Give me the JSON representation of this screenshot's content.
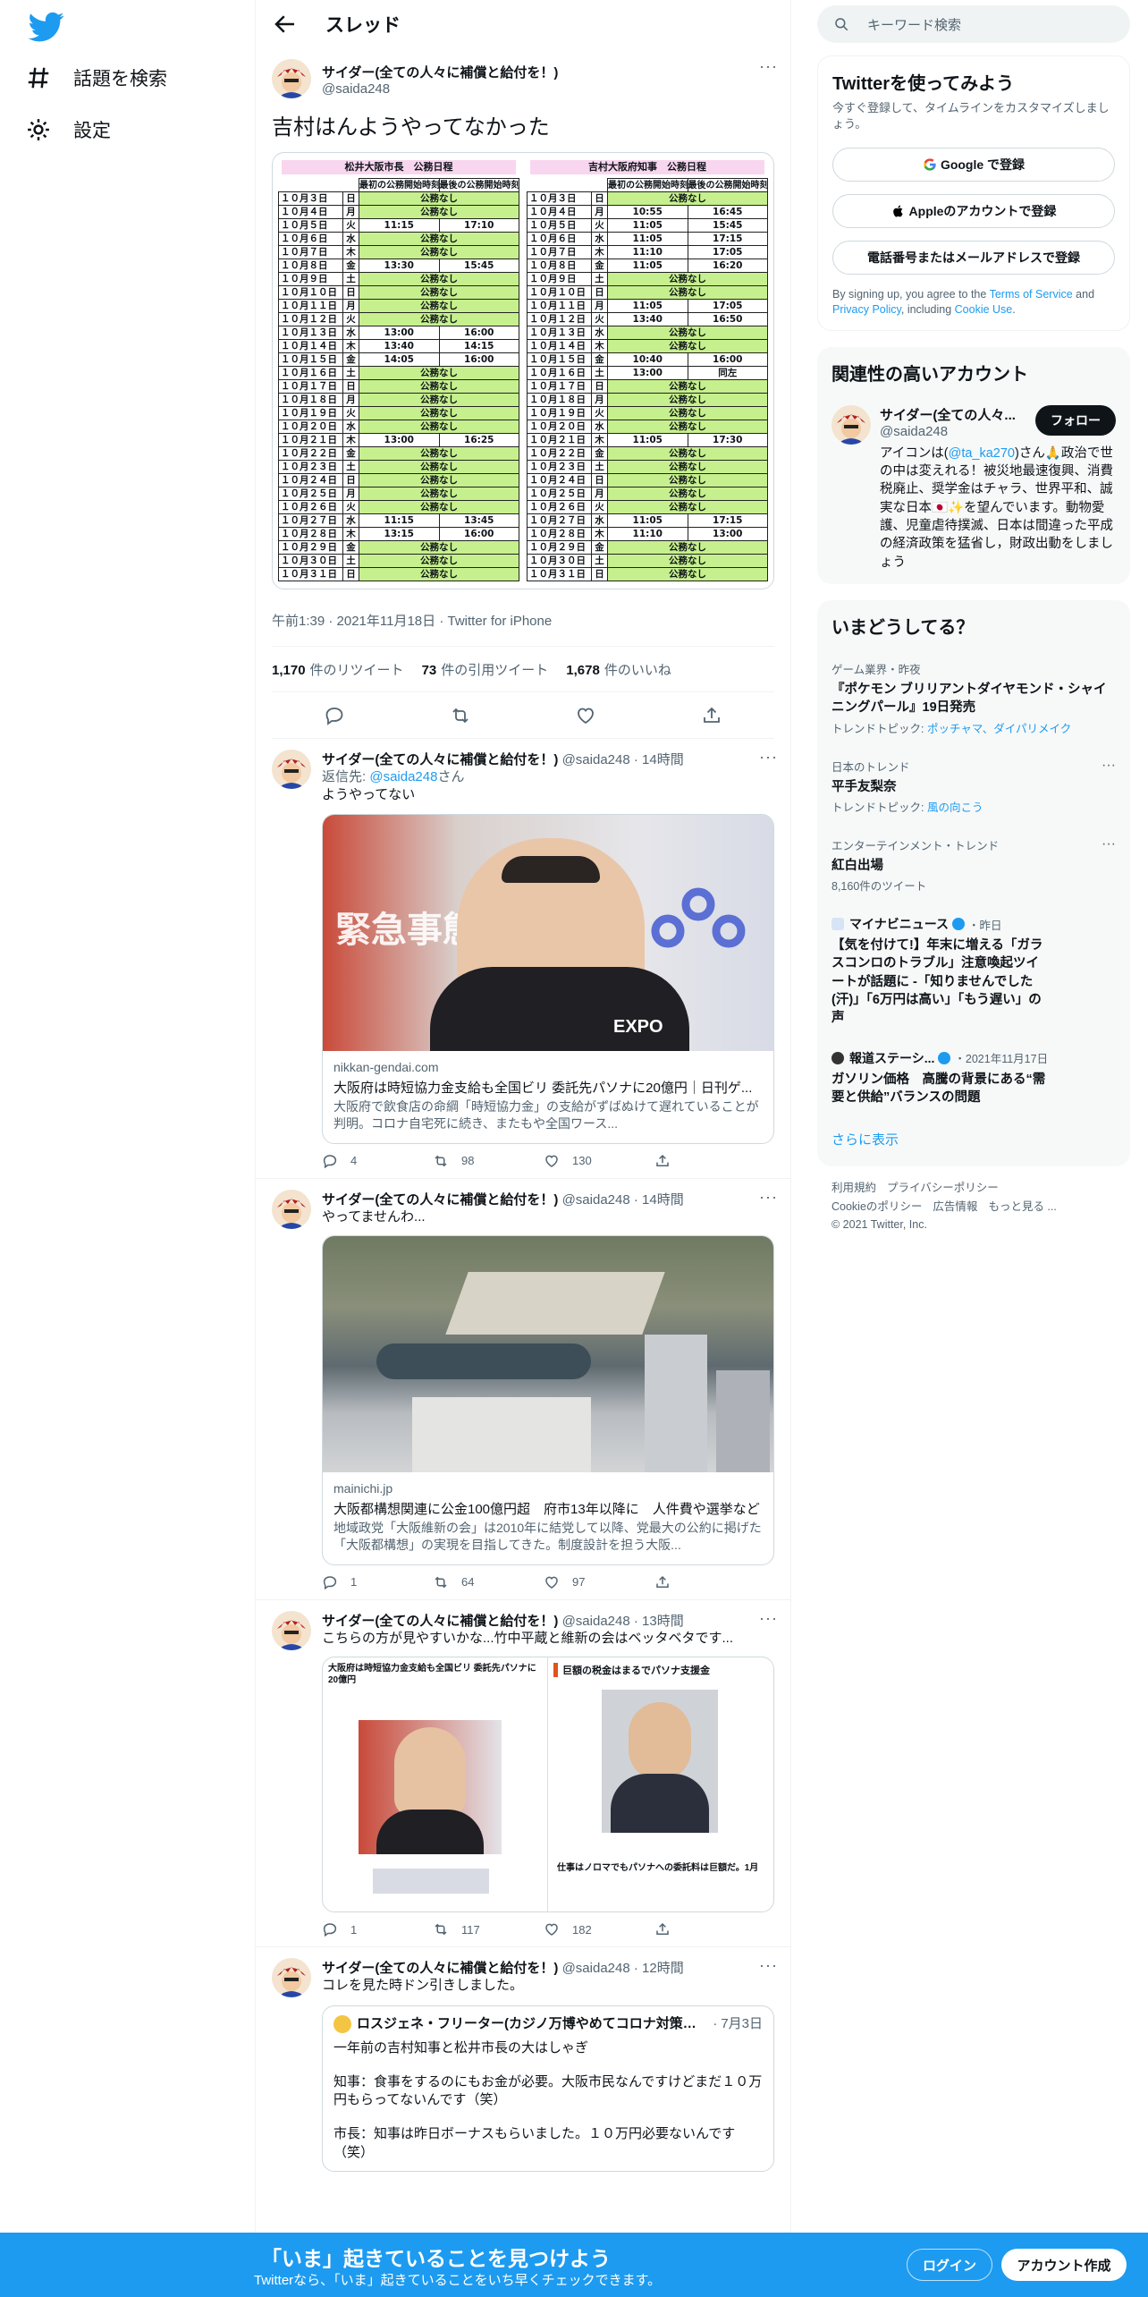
{
  "nav": {
    "explore_label": "話題を検索",
    "settings_label": "設定"
  },
  "header": {
    "title": "スレッド"
  },
  "focal_tweet": {
    "user_name": "サイダー(全ての人々に補償と給付を！)",
    "handle": "@saida248",
    "text": "吉村はんようやってなかった",
    "meta": "午前1:39 · 2021年11月18日 · Twitter for iPhone",
    "retweets": "1,170",
    "retweets_label": "件のリツイート",
    "quotes": "73",
    "quotes_label": "件の引用ツイート",
    "likes": "1,678",
    "likes_label": "件のいいね"
  },
  "schedule_image": {
    "left_title": "松井大阪市長　公務日程",
    "right_title": "吉村大阪府知事　公務日程",
    "col_start": "最初の公務開始時刻",
    "col_end": "最後の公務開始時刻",
    "left_rows": [
      [
        "１０月３日",
        "日",
        "公務なし",
        ""
      ],
      [
        "１０月４日",
        "月",
        "公務なし",
        ""
      ],
      [
        "１０月５日",
        "火",
        "11:15",
        "17:10"
      ],
      [
        "１０月６日",
        "水",
        "公務なし",
        ""
      ],
      [
        "１０月７日",
        "木",
        "公務なし",
        ""
      ],
      [
        "１０月８日",
        "金",
        "13:30",
        "15:45"
      ],
      [
        "１０月９日",
        "土",
        "公務なし",
        ""
      ],
      [
        "１０月１０日",
        "日",
        "公務なし",
        ""
      ],
      [
        "１０月１１日",
        "月",
        "公務なし",
        ""
      ],
      [
        "１０月１２日",
        "火",
        "公務なし",
        ""
      ],
      [
        "１０月１３日",
        "水",
        "13:00",
        "16:00"
      ],
      [
        "１０月１４日",
        "木",
        "13:40",
        "14:15"
      ],
      [
        "１０月１５日",
        "金",
        "14:05",
        "16:00"
      ],
      [
        "１０月１６日",
        "土",
        "公務なし",
        ""
      ],
      [
        "１０月１７日",
        "日",
        "公務なし",
        ""
      ],
      [
        "１０月１８日",
        "月",
        "公務なし",
        ""
      ],
      [
        "１０月１９日",
        "火",
        "公務なし",
        ""
      ],
      [
        "１０月２０日",
        "水",
        "公務なし",
        ""
      ],
      [
        "１０月２１日",
        "木",
        "13:00",
        "16:25"
      ],
      [
        "１０月２２日",
        "金",
        "公務なし",
        ""
      ],
      [
        "１０月２３日",
        "土",
        "公務なし",
        ""
      ],
      [
        "１０月２４日",
        "日",
        "公務なし",
        ""
      ],
      [
        "１０月２５日",
        "月",
        "公務なし",
        ""
      ],
      [
        "１０月２６日",
        "火",
        "公務なし",
        ""
      ],
      [
        "１０月２７日",
        "水",
        "11:15",
        "13:45"
      ],
      [
        "１０月２８日",
        "木",
        "13:15",
        "16:00"
      ],
      [
        "１０月２９日",
        "金",
        "公務なし",
        ""
      ],
      [
        "１０月３０日",
        "土",
        "公務なし",
        ""
      ],
      [
        "１０月３１日",
        "日",
        "公務なし",
        ""
      ]
    ],
    "right_rows": [
      [
        "１０月３日",
        "日",
        "公務なし",
        ""
      ],
      [
        "１０月４日",
        "月",
        "10:55",
        "16:45"
      ],
      [
        "１０月５日",
        "火",
        "11:05",
        "15:45"
      ],
      [
        "１０月６日",
        "水",
        "11:05",
        "17:15"
      ],
      [
        "１０月７日",
        "木",
        "11:10",
        "17:05"
      ],
      [
        "１０月８日",
        "金",
        "11:05",
        "16:20"
      ],
      [
        "１０月９日",
        "土",
        "公務なし",
        ""
      ],
      [
        "１０月１０日",
        "日",
        "公務なし",
        ""
      ],
      [
        "１０月１１日",
        "月",
        "11:05",
        "17:05"
      ],
      [
        "１０月１２日",
        "火",
        "13:40",
        "16:50"
      ],
      [
        "１０月１３日",
        "水",
        "公務なし",
        ""
      ],
      [
        "１０月１４日",
        "木",
        "公務なし",
        ""
      ],
      [
        "１０月１５日",
        "金",
        "10:40",
        "16:00"
      ],
      [
        "１０月１６日",
        "土",
        "13:00",
        "同左"
      ],
      [
        "１０月１７日",
        "日",
        "公務なし",
        ""
      ],
      [
        "１０月１８日",
        "月",
        "公務なし",
        ""
      ],
      [
        "１０月１９日",
        "火",
        "公務なし",
        ""
      ],
      [
        "１０月２０日",
        "水",
        "公務なし",
        ""
      ],
      [
        "１０月２１日",
        "木",
        "11:05",
        "17:30"
      ],
      [
        "１０月２２日",
        "金",
        "公務なし",
        ""
      ],
      [
        "１０月２３日",
        "土",
        "公務なし",
        ""
      ],
      [
        "１０月２４日",
        "日",
        "公務なし",
        ""
      ],
      [
        "１０月２５日",
        "月",
        "公務なし",
        ""
      ],
      [
        "１０月２６日",
        "火",
        "公務なし",
        ""
      ],
      [
        "１０月２７日",
        "水",
        "11:05",
        "17:15"
      ],
      [
        "１０月２８日",
        "木",
        "11:10",
        "13:00"
      ],
      [
        "１０月２９日",
        "金",
        "公務なし",
        ""
      ],
      [
        "１０月３０日",
        "土",
        "公務なし",
        ""
      ],
      [
        "１０月３１日",
        "日",
        "公務なし",
        ""
      ]
    ]
  },
  "replies": [
    {
      "user_name": "サイダー(全ての人々に補償と給付を！)",
      "handle": "@saida248",
      "time": "14時間",
      "reply_to_prefix": "返信先: ",
      "reply_to_handle": "@saida248",
      "reply_to_suffix": "さん",
      "text": "ようやってない",
      "card_domain": "nikkan-gendai.com",
      "card_title": "大阪府は時短協力金支給も全国ビリ 委託先パソナに20億円｜日刊ゲ...",
      "card_desc": "大阪府で飲食店の命綱「時短協力金」の支給がずばぬけて遅れていることが判明。コロナ自宅死に続き、またもや全国ワース...",
      "card_img_text1": "緊急事態",
      "card_img_text2": "EXPO",
      "replies": "4",
      "retweets": "98",
      "likes": "130"
    },
    {
      "user_name": "サイダー(全ての人々に補償と給付を！)",
      "handle": "@saida248",
      "time": "14時間",
      "text": "やってませんわ...",
      "card_domain": "mainichi.jp",
      "card_title": "大阪都構想関連に公金100億円超　府市13年以降に　人件費や選挙など",
      "card_desc": "地域政党「大阪維新の会」は2010年に結党して以降、党最大の公約に掲げた「大阪都構想」の実現を目指してきた。制度設計を担う大阪...",
      "replies": "1",
      "retweets": "64",
      "likes": "97"
    },
    {
      "user_name": "サイダー(全ての人々に補償と給付を！)",
      "handle": "@saida248",
      "time": "13時間",
      "text": "こちらの方が見やすいかな...竹中平蔵と維新の会はベッタベタです...",
      "img_left_title": "大阪府は時短協力金支給も全国ビリ 委託先パソナに20億円",
      "img_right_title": "巨額の税金はまるでパソナ支援金",
      "img_right_caption": "仕事はノロマでもパソナへの委託料は巨額だ。1月",
      "replies": "1",
      "retweets": "117",
      "likes": "182"
    },
    {
      "user_name": "サイダー(全ての人々に補償と給付を！)",
      "handle": "@saida248",
      "time": "12時間",
      "text": "コレを見た時ドン引きしました。",
      "quote_user": "ロスジェネ・フリーター(カジノ万博やめてコロナ対策に...",
      "quote_date": "7月3日",
      "quote_lines": [
        "一年前の吉村知事と松井市長の大はしゃぎ",
        "知事：食事をするのにもお金が必要。大阪市民なんですけどまだ１０万円もらってないんです（笑）",
        "市長：知事は昨日ボーナスもらいました。１０万円必要ないんです（笑）"
      ]
    }
  ],
  "sidebar": {
    "search_placeholder": "キーワード検索",
    "signup": {
      "title": "Twitterを使ってみよう",
      "sub": "今すぐ登録して、タイムラインをカスタマイズしましょう。",
      "google": "Google で登録",
      "apple": "Appleのアカウントで登録",
      "phone": "電話番号またはメールアドレスで登録",
      "terms_prefix": "By signing up, you agree to the ",
      "tos": "Terms of Service",
      "and": " and ",
      "privacy": "Privacy Policy",
      "including": ", including ",
      "cookie": "Cookie Use",
      "dot": "."
    },
    "related": {
      "title": "関連性の高いアカウント",
      "name": "サイダー(全ての人々...",
      "handle": "@saida248",
      "follow": "フォロー",
      "bio_prefix": "アイコンは(",
      "bio_link": "@ta_ka270",
      "bio_rest": ")さん🙏政治で世の中は変えれる！被災地最速復興、消費税廃止、奨学金はチャラ、世界平和、誠実な日本🇯🇵✨を望んでいます。動物愛護、児童虐待撲滅、日本は間違った平成の経済政策を猛省し，財政出動をしましょう"
    },
    "trends": {
      "title": "いまどうしてる？",
      "items": [
        {
          "context": "ゲーム業界・昨夜",
          "title": "『ポケモン ブリリアントダイヤモンド・シャイニングパール』19日発売",
          "meta": "トレンドトピック: ",
          "meta_link": "ポッチャマ、ダイパリメイク"
        },
        {
          "context": "日本のトレンド",
          "title": "平手友梨奈",
          "meta": "トレンドトピック: ",
          "meta_link": "風の向こう"
        },
        {
          "context": "エンターテインメント・トレンド",
          "title": "紅白出場",
          "meta": "8,160件のツイート",
          "meta_link": ""
        },
        {
          "context": "マイナビニュース",
          "context_time": "・昨日",
          "title": "【気を付けて!】年末に増える「ガラスコンロのトラブル」注意喚起ツイートが話題に -「知りませんでした(汗)」「6万円は高い」「もう遅い」の声",
          "meta": "",
          "meta_link": ""
        },
        {
          "context": "報道ステーシ...",
          "context_time": "・2021年11月17日",
          "title": "ガソリン価格　高騰の背景にある“需要と供給”バランスの問題",
          "meta": "",
          "meta_link": ""
        }
      ],
      "show_more": "さらに表示"
    },
    "footer": {
      "l1": "利用規約",
      "l2": "プライバシーポリシー",
      "l3": "Cookieのポリシー",
      "l4": "広告情報",
      "l5": "もっと見る ...",
      "copyright": "© 2021 Twitter, Inc."
    }
  },
  "bottom_bar": {
    "title": "「いま」起きていることを見つけよう",
    "sub": "Twitterなら、「いま」起きていることをいち早くチェックできます。",
    "login": "ログイン",
    "signup": "アカウント作成"
  },
  "colors": {
    "accent": "#1d9bf0",
    "schedule_green": "#c6f08d",
    "schedule_pink": "#f9d6ef"
  }
}
